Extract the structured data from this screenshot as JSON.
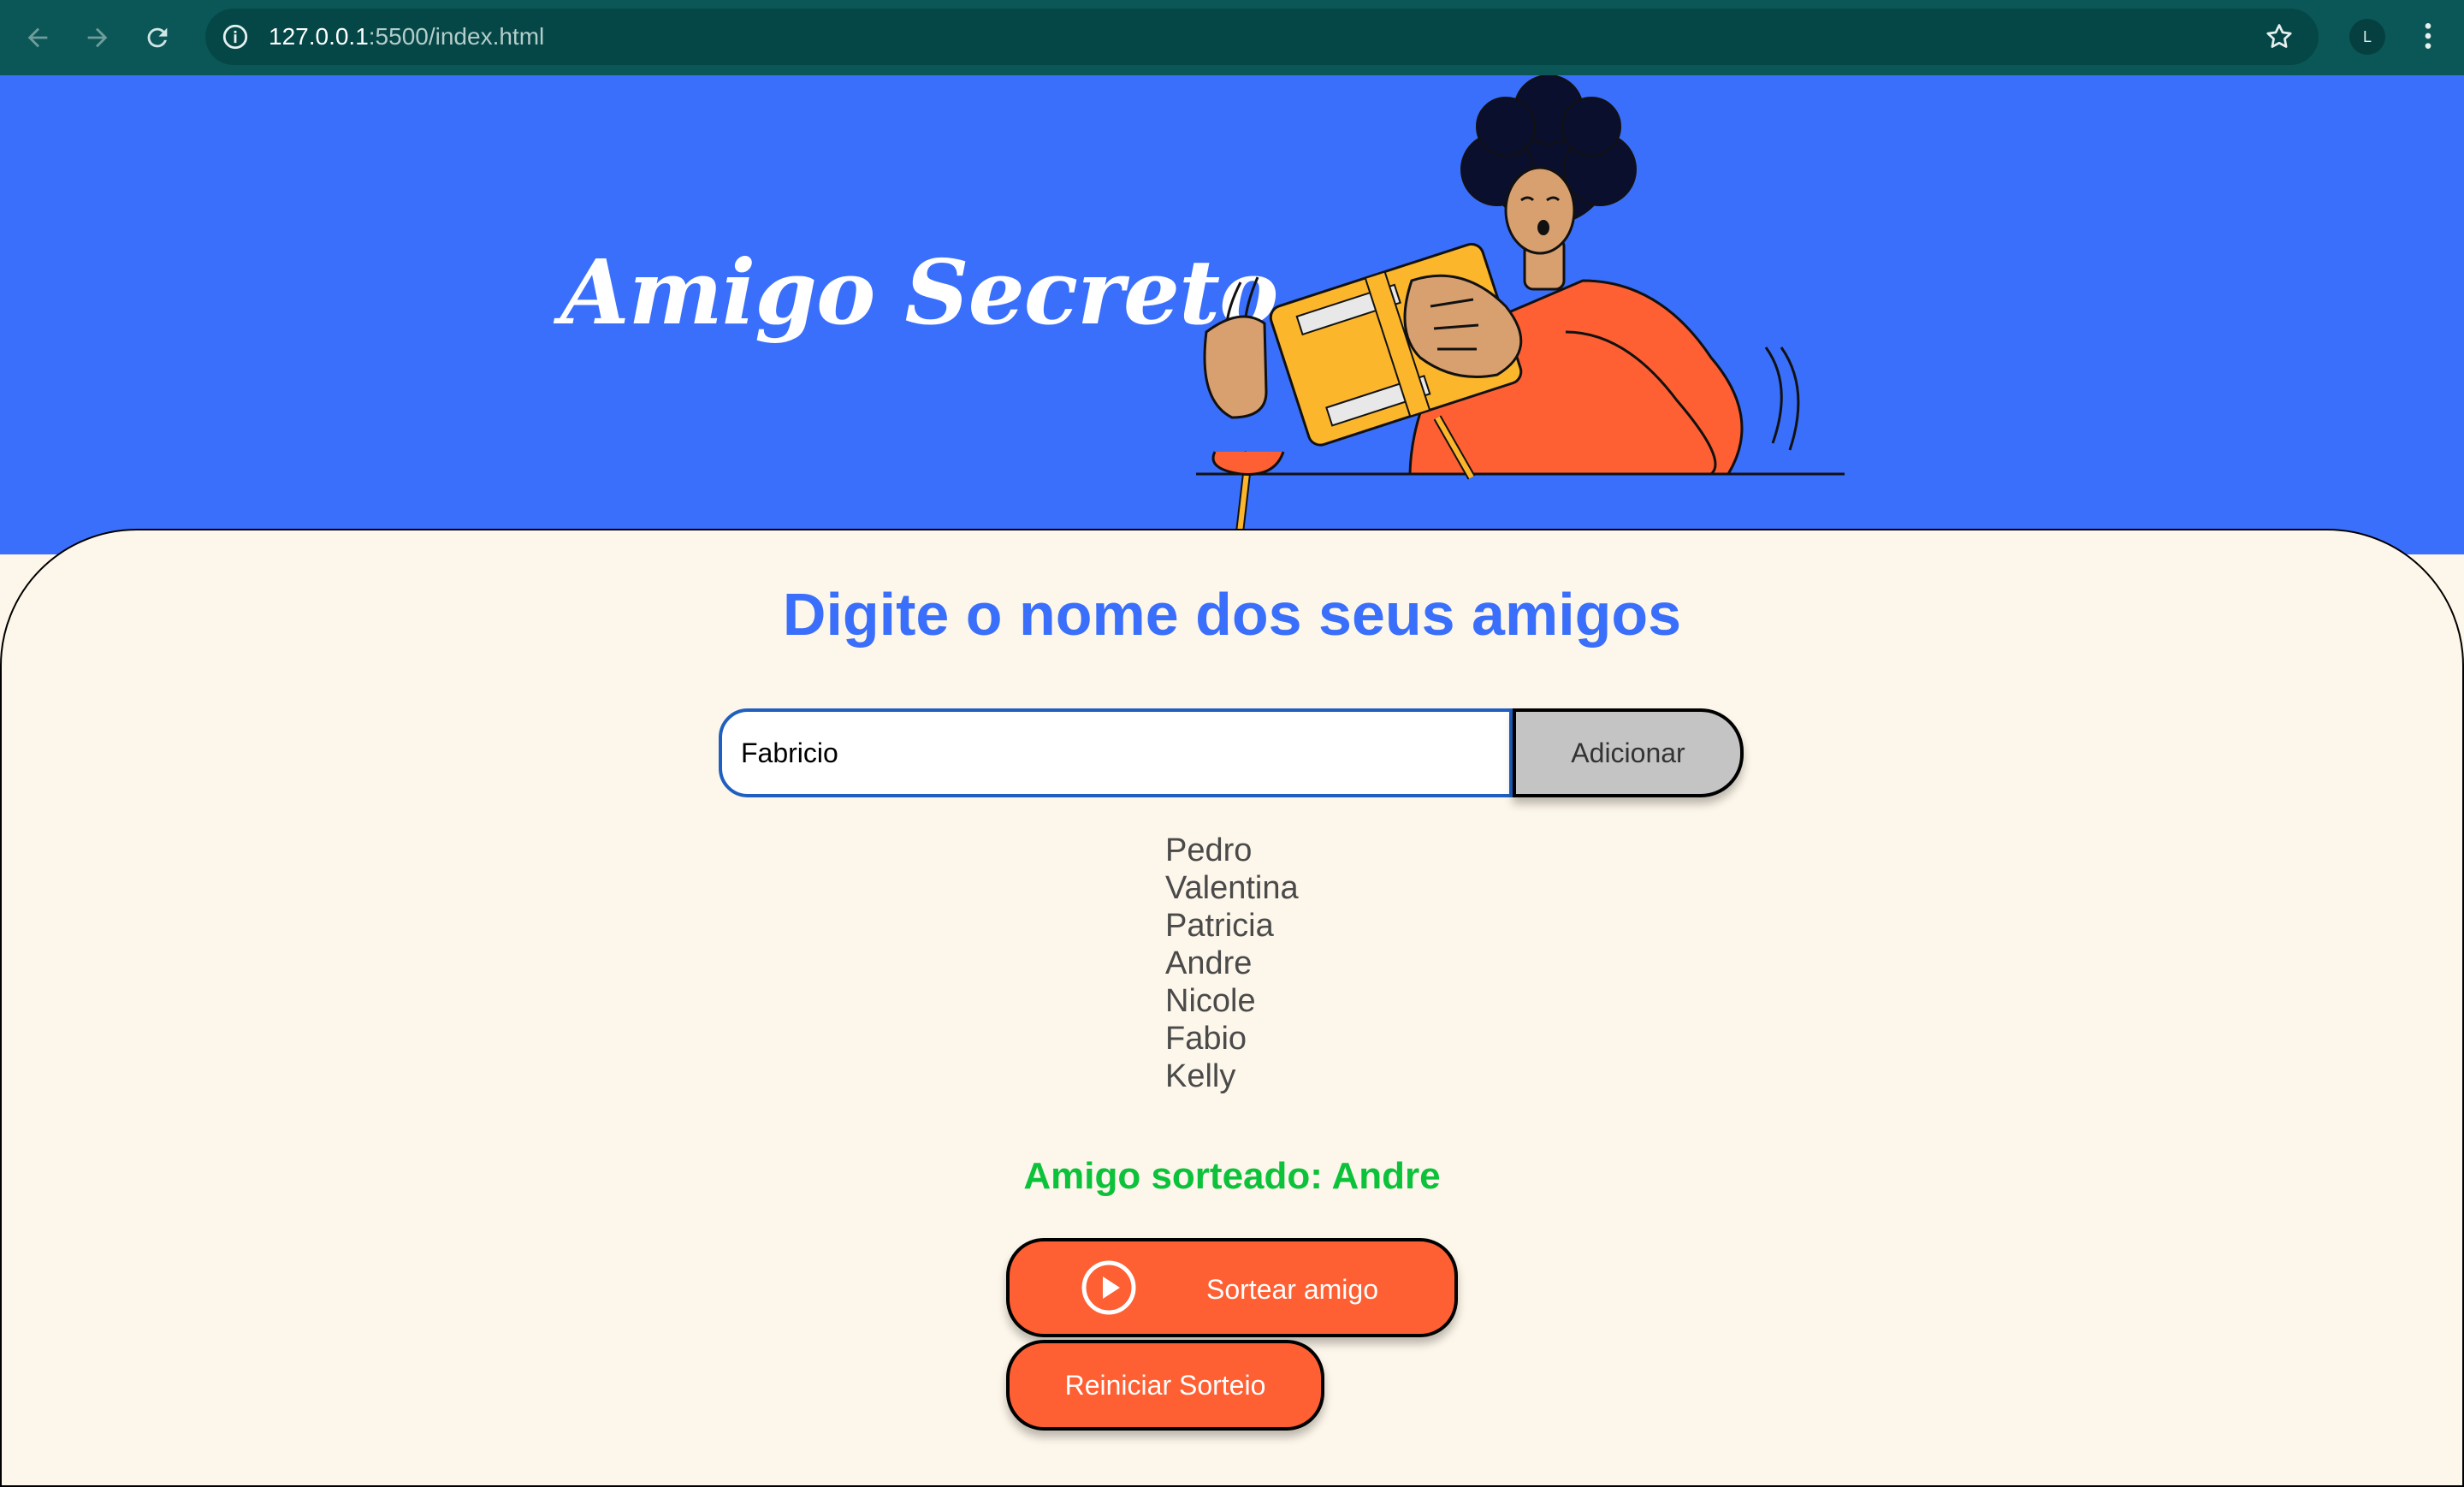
{
  "browser": {
    "url_host": "127.0.0.1",
    "url_path": ":5500/index.html",
    "profile_initial": "L"
  },
  "banner": {
    "title": "Amigo Secreto"
  },
  "main": {
    "heading": "Digite o nome dos seus amigos",
    "input_value": "Fabricio",
    "add_button_label": "Adicionar",
    "friends": [
      "Pedro",
      "Valentina",
      "Patricia",
      "Andre",
      "Nicole",
      "Fabio",
      "Kelly"
    ],
    "result": "Amigo sorteado: Andre",
    "draw_button_label": "Sortear amigo",
    "reset_button_label": "Reiniciar Sorteio"
  },
  "colors": {
    "banner_bg": "#3a6ffb",
    "card_bg": "#fdf6ea",
    "heading": "#3a6ffb",
    "result": "#0cc23a",
    "action_button": "#fe5f33",
    "chrome_bg": "#0b5757"
  },
  "icons": {
    "back": "arrow-left-icon",
    "forward": "arrow-right-icon",
    "reload": "reload-icon",
    "site_info": "info-icon",
    "bookmark": "star-icon",
    "menu": "more-vert-icon",
    "draw": "play-circle-icon"
  }
}
